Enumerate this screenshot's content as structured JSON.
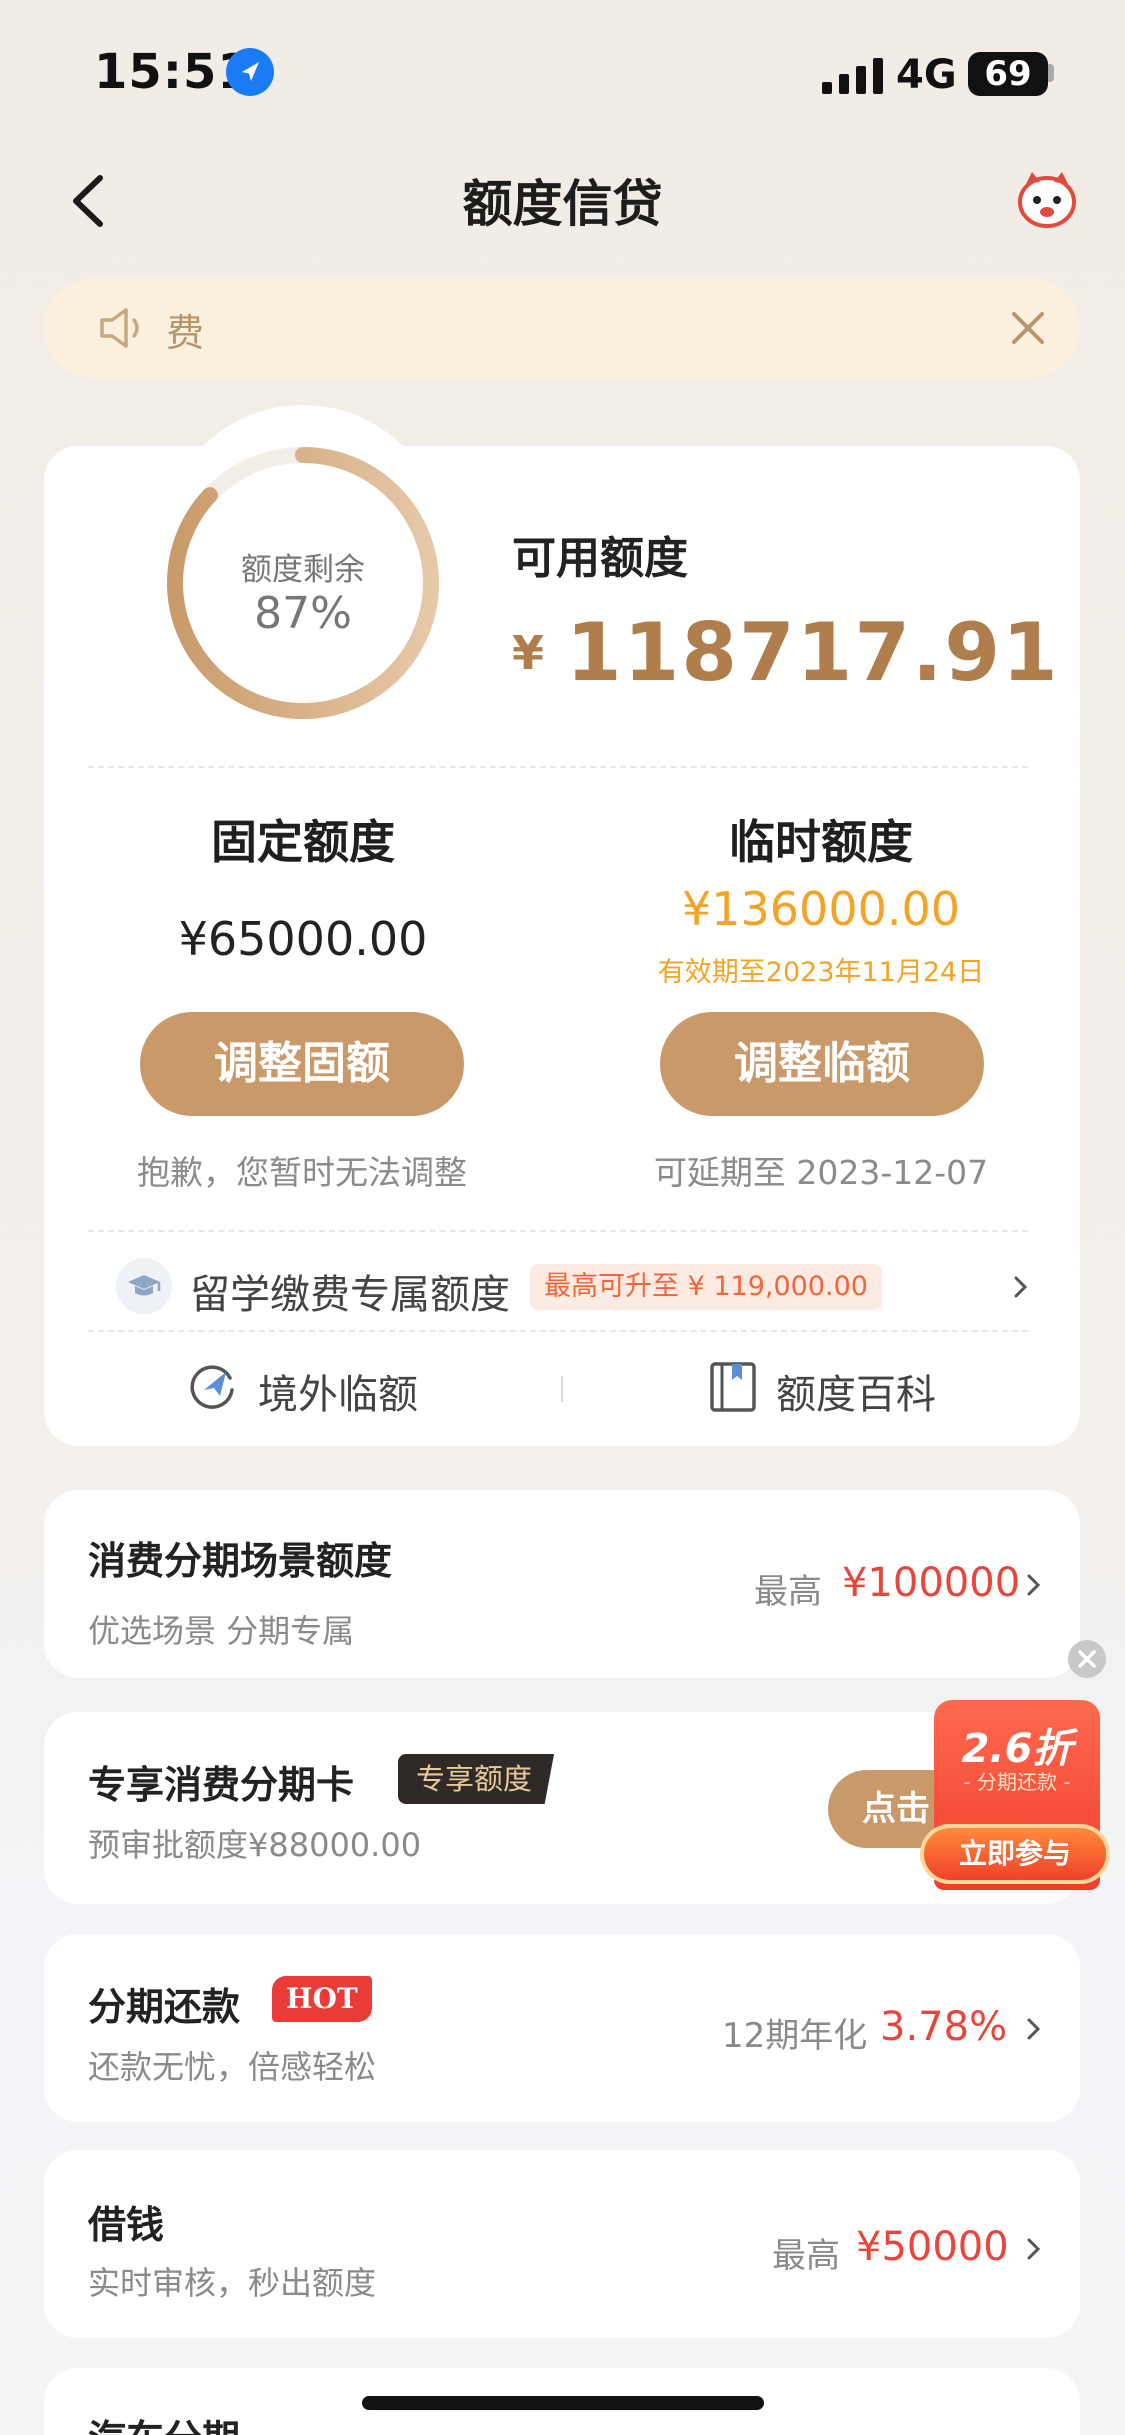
{
  "status_bar": {
    "time": "15:51",
    "network": "4G",
    "battery": "69"
  },
  "nav": {
    "title": "额度信贷"
  },
  "notice": {
    "text": "费"
  },
  "quota": {
    "ring_label": "额度剩余",
    "ring_percent_text": "87%",
    "ring_fraction": 0.87,
    "available_label": "可用额度",
    "available_currency": "¥",
    "available_amount": "118717.91",
    "fixed": {
      "title": "固定额度",
      "amount": "¥65000.00",
      "button": "调整固额",
      "note": "抱歉，您暂时无法调整"
    },
    "temporary": {
      "title": "临时额度",
      "amount": "¥136000.00",
      "valid_until": "有效期至2023年11月24日",
      "button": "调整临额",
      "note": "可延期至 2023-12-07"
    },
    "study": {
      "label": "留学缴费专属额度",
      "tag": "最高可升至 ¥ 119,000.00"
    },
    "links": [
      {
        "label": "境外临额",
        "icon": "plane-return-icon"
      },
      {
        "label": "额度百科",
        "icon": "book-icon"
      }
    ]
  },
  "rows": [
    {
      "title": "消费分期场景额度",
      "subtitle": "优选场景 分期专属",
      "prefix": "最高",
      "value": "¥100000"
    },
    {
      "title": "专享消费分期卡",
      "badge": "专享额度",
      "subtitle": "预审批额度¥88000.00",
      "button": "点击"
    },
    {
      "title": "分期还款",
      "badge": "HOT",
      "subtitle": "还款无忧，倍感轻松",
      "prefix": "12期年化",
      "value": "3.78%"
    },
    {
      "title": "借钱",
      "subtitle": "实时审核，秒出额度",
      "prefix": "最高",
      "value": "¥50000"
    },
    {
      "title": "汽车分期"
    }
  ],
  "promo": {
    "big": "2.6折",
    "small": "- 分期还款 -",
    "button": "立即参与"
  },
  "colors": {
    "accent": "#c9996a",
    "gold_text": "#b07e4c",
    "orange": "#f3a424",
    "red": "#e8453c"
  }
}
